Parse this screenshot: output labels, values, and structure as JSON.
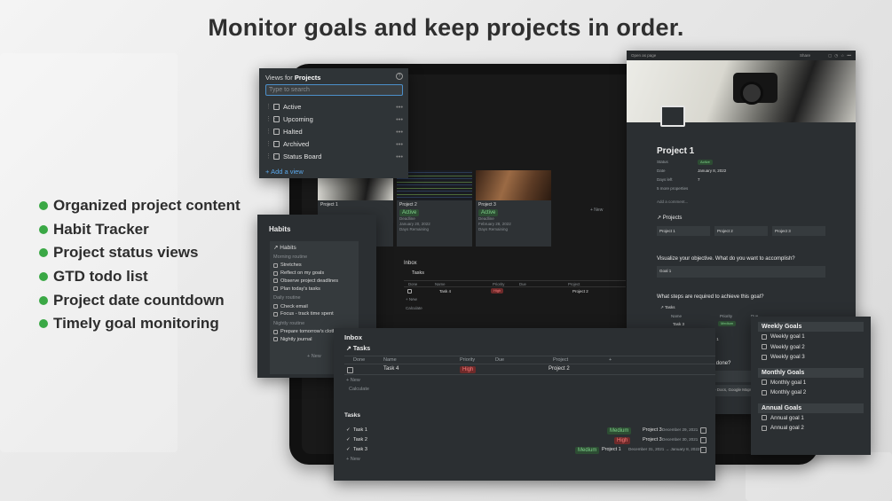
{
  "headline": "Monitor goals and keep projects in order.",
  "features": [
    "Organized project content",
    "Habit Tracker",
    "Project status views",
    "GTD todo list",
    "Project date countdown",
    "Timely goal monitoring"
  ],
  "colors": {
    "accent_green": "#3aa845",
    "panel_bg": "#2f3437",
    "link_blue": "#5aa6e8",
    "high": "#ff7a7a",
    "medium": "#7fd28a"
  },
  "views_panel": {
    "title_prefix": "Views for",
    "title_target": "Projects",
    "search_placeholder": "Type to search",
    "items": [
      "Active",
      "Upcoming",
      "Halted",
      "Archived",
      "Status Board"
    ],
    "add_label": "Add a view"
  },
  "gallery": {
    "cards": [
      {
        "name": "Project 1",
        "status": "",
        "label": "",
        "date": "",
        "remaining": ""
      },
      {
        "name": "Project 2",
        "status": "Active",
        "label": "Deadline",
        "date": "January 20, 2022",
        "remaining": "Days Remaining"
      },
      {
        "name": "Project 3",
        "status": "Active",
        "label": "Deadline",
        "date": "February 28, 2022",
        "remaining": "Days Remaining"
      }
    ],
    "new_label": "+ New"
  },
  "habits": {
    "title": "Habits",
    "sub_title": "Habits",
    "sections": [
      {
        "name": "Morning routine",
        "items": [
          "Stretches",
          "Reflect on my goals",
          "Observe project deadlines",
          "Plan today's tasks"
        ]
      },
      {
        "name": "Daily routine",
        "items": [
          "Check email",
          "Focus - track time spent"
        ]
      },
      {
        "name": "Nightly routine",
        "items": [
          "Prepare tomorrow's clothes",
          "Nightly journal"
        ]
      }
    ],
    "new_label": "+ New"
  },
  "project_page": {
    "topbar_left": "Open as page",
    "topbar_share": "Share",
    "title": "Project 1",
    "props": [
      {
        "label": "Status",
        "value": "Active"
      },
      {
        "label": "Date",
        "value": "January 8, 2022"
      },
      {
        "label": "Days left",
        "value": "7"
      }
    ],
    "more_props": "5 more properties",
    "comment": "Add a comment...",
    "projects_heading": "Projects",
    "projects": [
      "Project 1",
      "Project 2",
      "Project 3"
    ],
    "q1": "Visualize your objective. What do you want to accomplish?",
    "goal": "Goal 1",
    "q2": "What steps are required to achieve this goal?",
    "tasks_heading": "Tasks",
    "task_cols": [
      "Name",
      "Priority",
      "Due"
    ],
    "task_row": {
      "name": "Task 3",
      "priority": "Medium"
    },
    "count_label": "COUNT",
    "count_value": "1",
    "q3": "What research have you done?",
    "bookmark": "Add a web bookmark",
    "embed": "Embed anything (PDFs, Google Docs, Google Maps, ..."
  },
  "inbox": {
    "title": "Inbox",
    "tasks_heading": "Tasks",
    "columns": [
      "Done",
      "Name",
      "Priority",
      "Due",
      "Project"
    ],
    "row": {
      "name": "Task 4",
      "priority": "High",
      "project": "Project 2"
    },
    "new_label": "+ New",
    "calculate_label": "Calculate",
    "list_heading": "Tasks",
    "list": [
      {
        "name": "Task 1",
        "priority": "Medium",
        "project": "Project 3",
        "date": "December 29, 2021"
      },
      {
        "name": "Task 2",
        "priority": "High",
        "project": "Project 3",
        "date": "December 30, 2021"
      },
      {
        "name": "Task 3",
        "priority": "Medium",
        "project": "Project 1",
        "date": "December 31, 2021 → January 8, 2022"
      }
    ],
    "list_new": "+ New"
  },
  "tablet_inbox": {
    "title": "Inbox",
    "tasks_heading": "Tasks",
    "columns": [
      "Done",
      "Name",
      "Priority",
      "Due",
      "Project"
    ],
    "row": {
      "name": "Task 4",
      "priority": "High",
      "project": "Project 2"
    },
    "new_label": "+ New",
    "calculate_label": "Calculate"
  },
  "goals": {
    "groups": [
      {
        "title": "Weekly Goals",
        "items": [
          "Weekly goal 1",
          "Weekly goal 2",
          "Weekly goal 3"
        ]
      },
      {
        "title": "Monthly Goals",
        "items": [
          "Monthly goal 1",
          "Monthly goal 2"
        ]
      },
      {
        "title": "Annual Goals",
        "items": [
          "Annual goal 1",
          "Annual goal 2"
        ]
      }
    ]
  }
}
